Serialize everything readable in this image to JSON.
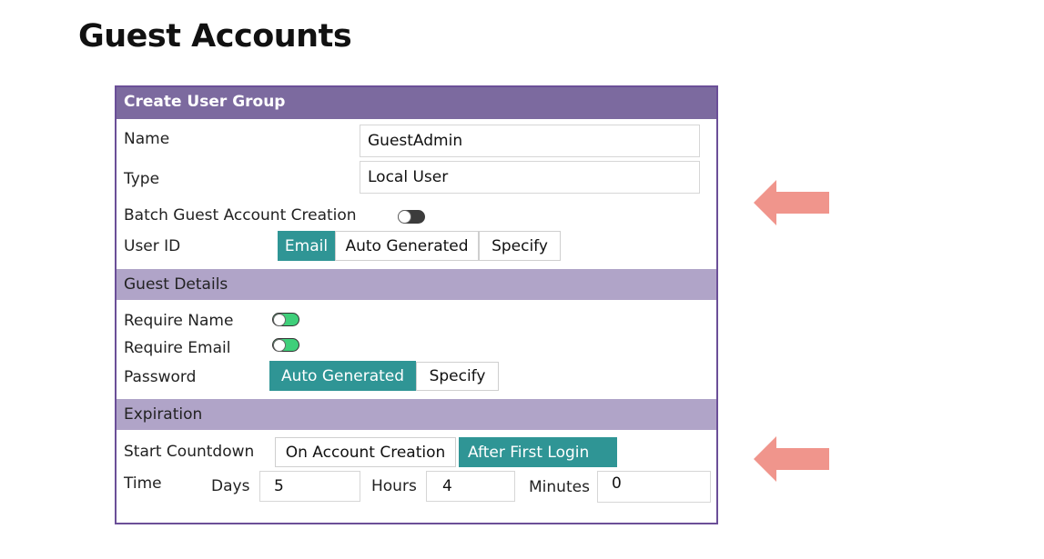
{
  "page": {
    "title": "Guest Accounts"
  },
  "form": {
    "header": "Create User Group",
    "name": {
      "label": "Name",
      "value": "GuestAdmin"
    },
    "type": {
      "label": "Type",
      "value": "Local User"
    },
    "batch": {
      "label": "Batch Guest Account Creation",
      "enabled": false
    },
    "user_id": {
      "label": "User ID",
      "options": [
        "Email",
        "Auto Generated",
        "Specify"
      ],
      "selected": "Email"
    }
  },
  "guest_details": {
    "header": "Guest Details",
    "require_name": {
      "label": "Require Name",
      "enabled": true
    },
    "require_email": {
      "label": "Require Email",
      "enabled": true
    },
    "password": {
      "label": "Password",
      "options": [
        "Auto Generated",
        "Specify"
      ],
      "selected": "Auto Generated"
    }
  },
  "expiration": {
    "header": "Expiration",
    "start_countdown": {
      "label": "Start Countdown",
      "options": [
        "On Account Creation",
        "After First Login"
      ],
      "selected": "After First Login"
    },
    "time": {
      "label": "Time",
      "days_label": "Days",
      "days": "5",
      "hours_label": "Hours",
      "hours": "4",
      "minutes_label": "Minutes",
      "minutes": "0"
    }
  },
  "colors": {
    "header": "#7c6a9f",
    "section": "#b0a4c8",
    "accent": "#2f9595",
    "toggle_on": "#3fcf7a",
    "arrow": "#f0958c"
  }
}
